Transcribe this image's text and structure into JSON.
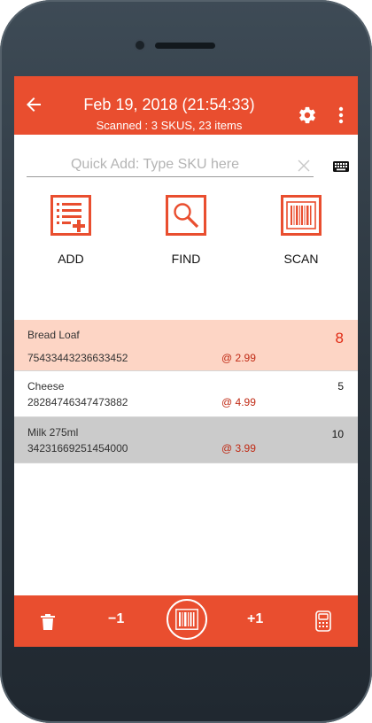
{
  "header": {
    "title": "Feb 19, 2018 (21:54:33)",
    "subtitle": "Scanned : 3 SKUS, 23 items"
  },
  "quick_add": {
    "placeholder": "Quick Add: Type SKU here",
    "value": ""
  },
  "actions": [
    {
      "label": "ADD",
      "icon": "add-list-icon"
    },
    {
      "label": "FIND",
      "icon": "find-magnifier-icon"
    },
    {
      "label": "SCAN",
      "icon": "barcode-scan-icon"
    }
  ],
  "items": [
    {
      "name": "Bread Loaf",
      "sku": "75433443236633452",
      "price": "@ 2.99",
      "qty": "8",
      "state": "highlighted"
    },
    {
      "name": "Cheese",
      "sku": "28284746347473882",
      "price": "@ 4.99",
      "qty": "5",
      "state": "normal"
    },
    {
      "name": "Milk 275ml",
      "sku": "34231669251454000",
      "price": "@ 3.99",
      "qty": "10",
      "state": "selected"
    }
  ],
  "bottom_bar": {
    "minus_label": "−1",
    "plus_label": "+1",
    "icons": [
      "trash-icon",
      "barcode-scan-icon",
      "calculator-icon"
    ]
  },
  "colors": {
    "accent": "#e94e2f",
    "highlight_row": "#fdd5c5",
    "selected_row": "#cbcbcb",
    "price_text": "#c02a14"
  }
}
